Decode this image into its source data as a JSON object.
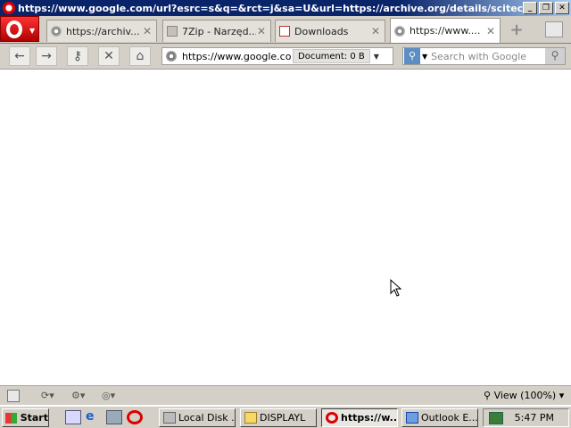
{
  "window": {
    "title": "https://www.google.com/url?esrc=s&q=&rct=j&sa=U&url=https://archive.org/details/scitechdo...",
    "minimize_label": "_",
    "restore_label": "❐",
    "close_label": "✕"
  },
  "tabs": [
    {
      "label": "https://archiv...",
      "icon": "globe-icon"
    },
    {
      "label": "7Zip - Narzęd...",
      "icon": "document-icon"
    },
    {
      "label": "Downloads",
      "icon": "downloads-icon"
    },
    {
      "label": "https://www....",
      "icon": "globe-icon",
      "active": true
    }
  ],
  "toolbar": {
    "back_icon": "←",
    "forward_icon": "→",
    "wand_icon": "⚷",
    "stop_icon": "✕",
    "home_icon": "⌂",
    "address": "https://www.google.com",
    "document_info": "Document:   0 B",
    "search_placeholder": "Search with Google"
  },
  "statusbar": {
    "zoom_label": "View (100%)"
  },
  "taskbar": {
    "start_label": "Start",
    "tasks": [
      {
        "label": "Local Disk ..."
      },
      {
        "label": "DISPLAYL"
      },
      {
        "label": "https://w...",
        "active": true
      },
      {
        "label": "Outlook E..."
      }
    ],
    "clock": "5:47 PM"
  }
}
